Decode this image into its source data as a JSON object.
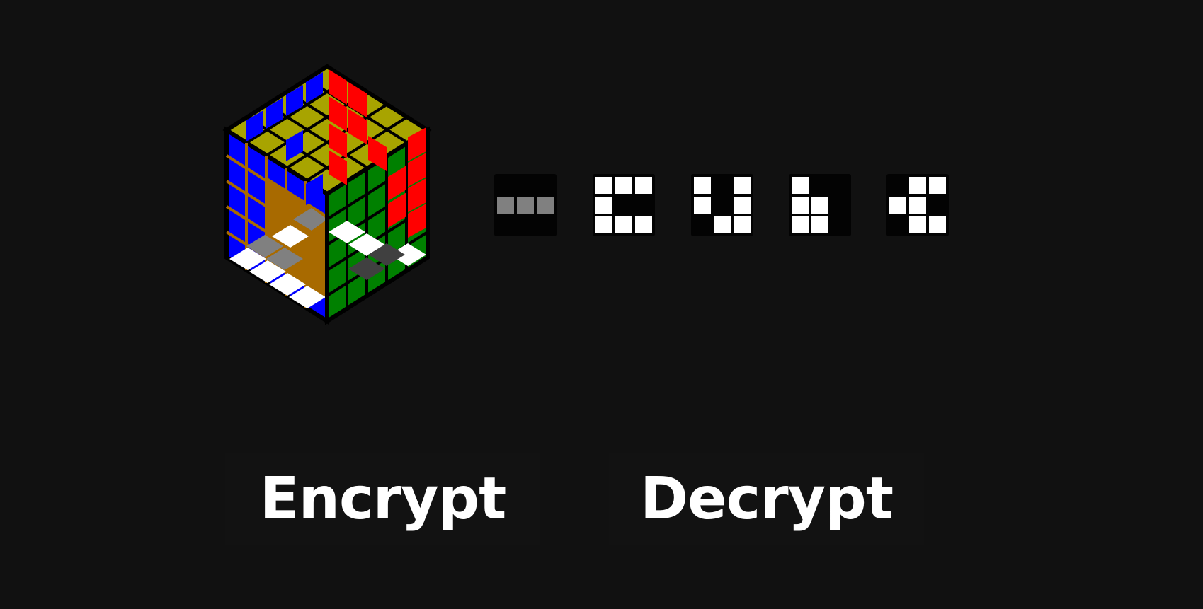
{
  "colors": {
    "background": "#111111",
    "cube_faces": {
      "blue": "#0000ff",
      "yellow": "#a8a400",
      "red": "#ff0000",
      "green": "#008000",
      "white": "#ffffff",
      "orange": "#a86a00",
      "gray": "#808080",
      "dark_gray": "#404040"
    },
    "glyph_on": "#ffffff",
    "glyph_dim": "#808080",
    "glyph_bg": "#030303"
  },
  "glyphs": [
    {
      "label": "glyph-1",
      "color": "#808080",
      "cells": [
        0,
        0,
        0,
        1,
        1,
        1,
        0,
        0,
        0
      ]
    },
    {
      "label": "glyph-2",
      "color": "#ffffff",
      "cells": [
        1,
        1,
        1,
        1,
        0,
        0,
        1,
        1,
        1
      ]
    },
    {
      "label": "glyph-3",
      "color": "#ffffff",
      "cells": [
        1,
        0,
        1,
        1,
        0,
        1,
        0,
        1,
        1
      ]
    },
    {
      "label": "glyph-4",
      "color": "#ffffff",
      "cells": [
        1,
        0,
        0,
        1,
        1,
        0,
        1,
        1,
        0
      ]
    },
    {
      "label": "glyph-5",
      "color": "#ffffff",
      "cells": [
        0,
        1,
        1,
        1,
        1,
        0,
        0,
        1,
        1
      ]
    }
  ],
  "actions": {
    "encrypt_label": "Encrypt",
    "decrypt_label": "Decrypt"
  }
}
